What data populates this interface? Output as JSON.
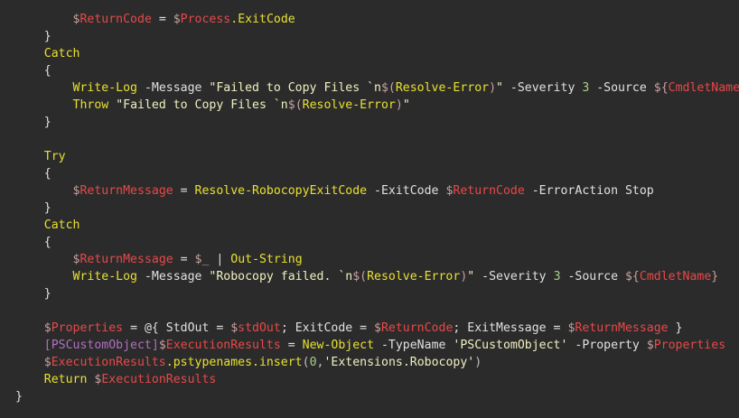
{
  "editor": {
    "lines": [
      [
        {
          "t": "        ",
          "k": "plain"
        },
        {
          "t": "$",
          "k": "dollar"
        },
        {
          "t": "ReturnCode",
          "k": "var"
        },
        {
          "t": " = ",
          "k": "operator"
        },
        {
          "t": "$",
          "k": "dollar"
        },
        {
          "t": "Process",
          "k": "var"
        },
        {
          "t": ".ExitCode",
          "k": "cmdlet"
        }
      ],
      [
        {
          "t": "    }",
          "k": "plain"
        }
      ],
      [
        {
          "t": "    ",
          "k": "plain"
        },
        {
          "t": "Catch",
          "k": "keyword"
        }
      ],
      [
        {
          "t": "    {",
          "k": "plain"
        }
      ],
      [
        {
          "t": "        ",
          "k": "plain"
        },
        {
          "t": "Write-Log",
          "k": "cmdlet"
        },
        {
          "t": " -Message ",
          "k": "param"
        },
        {
          "t": "\"Failed to Copy Files `n",
          "k": "string"
        },
        {
          "t": "$(",
          "k": "dollar"
        },
        {
          "t": "Resolve-Error",
          "k": "cmdlet"
        },
        {
          "t": ")",
          "k": "dollar"
        },
        {
          "t": "\"",
          "k": "string"
        },
        {
          "t": " -Severity ",
          "k": "param"
        },
        {
          "t": "3",
          "k": "number"
        },
        {
          "t": " -Source ",
          "k": "param"
        },
        {
          "t": "${",
          "k": "dollar"
        },
        {
          "t": "CmdletName",
          "k": "var"
        },
        {
          "t": "}",
          "k": "dollar"
        }
      ],
      [
        {
          "t": "        ",
          "k": "plain"
        },
        {
          "t": "Throw",
          "k": "keyword"
        },
        {
          "t": " ",
          "k": "plain"
        },
        {
          "t": "\"Failed to Copy Files `n",
          "k": "string"
        },
        {
          "t": "$(",
          "k": "dollar"
        },
        {
          "t": "Resolve-Error",
          "k": "cmdlet"
        },
        {
          "t": ")",
          "k": "dollar"
        },
        {
          "t": "\"",
          "k": "string"
        }
      ],
      [
        {
          "t": "    }",
          "k": "plain"
        }
      ],
      [],
      [
        {
          "t": "    ",
          "k": "plain"
        },
        {
          "t": "Try",
          "k": "keyword"
        }
      ],
      [
        {
          "t": "    {",
          "k": "plain"
        }
      ],
      [
        {
          "t": "        ",
          "k": "plain"
        },
        {
          "t": "$",
          "k": "dollar"
        },
        {
          "t": "ReturnMessage",
          "k": "var"
        },
        {
          "t": " = ",
          "k": "operator"
        },
        {
          "t": "Resolve-RobocopyExitCode",
          "k": "cmdlet"
        },
        {
          "t": " -ExitCode ",
          "k": "param"
        },
        {
          "t": "$",
          "k": "dollar"
        },
        {
          "t": "ReturnCode",
          "k": "var"
        },
        {
          "t": " -ErrorAction Stop",
          "k": "param"
        }
      ],
      [
        {
          "t": "    }",
          "k": "plain"
        }
      ],
      [
        {
          "t": "    ",
          "k": "plain"
        },
        {
          "t": "Catch",
          "k": "keyword"
        }
      ],
      [
        {
          "t": "    {",
          "k": "plain"
        }
      ],
      [
        {
          "t": "        ",
          "k": "plain"
        },
        {
          "t": "$",
          "k": "dollar"
        },
        {
          "t": "ReturnMessage",
          "k": "var"
        },
        {
          "t": " = ",
          "k": "operator"
        },
        {
          "t": "$_",
          "k": "dollar"
        },
        {
          "t": " | ",
          "k": "operator"
        },
        {
          "t": "Out-String",
          "k": "cmdlet"
        }
      ],
      [
        {
          "t": "        ",
          "k": "plain"
        },
        {
          "t": "Write-Log",
          "k": "cmdlet"
        },
        {
          "t": " -Message ",
          "k": "param"
        },
        {
          "t": "\"Robocopy failed. `n",
          "k": "string"
        },
        {
          "t": "$(",
          "k": "dollar"
        },
        {
          "t": "Resolve-Error",
          "k": "cmdlet"
        },
        {
          "t": ")",
          "k": "dollar"
        },
        {
          "t": "\"",
          "k": "string"
        },
        {
          "t": " -Severity ",
          "k": "param"
        },
        {
          "t": "3",
          "k": "number"
        },
        {
          "t": " -Source ",
          "k": "param"
        },
        {
          "t": "${",
          "k": "dollar"
        },
        {
          "t": "CmdletName",
          "k": "var"
        },
        {
          "t": "}",
          "k": "dollar"
        }
      ],
      [
        {
          "t": "    }",
          "k": "plain"
        }
      ],
      [],
      [
        {
          "t": "    ",
          "k": "plain"
        },
        {
          "t": "$",
          "k": "dollar"
        },
        {
          "t": "Properties",
          "k": "var"
        },
        {
          "t": " = @{ StdOut = ",
          "k": "operator"
        },
        {
          "t": "$",
          "k": "dollar"
        },
        {
          "t": "stdOut",
          "k": "var"
        },
        {
          "t": "; ExitCode = ",
          "k": "operator"
        },
        {
          "t": "$",
          "k": "dollar"
        },
        {
          "t": "ReturnCode",
          "k": "var"
        },
        {
          "t": "; ExitMessage = ",
          "k": "operator"
        },
        {
          "t": "$",
          "k": "dollar"
        },
        {
          "t": "ReturnMessage",
          "k": "var"
        },
        {
          "t": " }",
          "k": "operator"
        }
      ],
      [
        {
          "t": "    ",
          "k": "plain"
        },
        {
          "t": "[PSCustomObject]",
          "k": "type"
        },
        {
          "t": "$",
          "k": "dollar"
        },
        {
          "t": "ExecutionResults",
          "k": "var"
        },
        {
          "t": " = ",
          "k": "operator"
        },
        {
          "t": "New-Object",
          "k": "cmdlet"
        },
        {
          "t": " -TypeName ",
          "k": "param"
        },
        {
          "t": "'PSCustomObject'",
          "k": "string"
        },
        {
          "t": " -Property ",
          "k": "param"
        },
        {
          "t": "$",
          "k": "dollar"
        },
        {
          "t": "Properties",
          "k": "var"
        }
      ],
      [
        {
          "t": "    ",
          "k": "plain"
        },
        {
          "t": "$",
          "k": "dollar"
        },
        {
          "t": "ExecutionResults",
          "k": "var"
        },
        {
          "t": ".pstypenames.insert",
          "k": "cmdlet"
        },
        {
          "t": "(",
          "k": "punct"
        },
        {
          "t": "0",
          "k": "number"
        },
        {
          "t": ",",
          "k": "punct"
        },
        {
          "t": "'Extensions.Robocopy'",
          "k": "string"
        },
        {
          "t": ")",
          "k": "punct"
        }
      ],
      [
        {
          "t": "    ",
          "k": "plain"
        },
        {
          "t": "Return",
          "k": "keyword"
        },
        {
          "t": " ",
          "k": "plain"
        },
        {
          "t": "$",
          "k": "dollar"
        },
        {
          "t": "ExecutionResults",
          "k": "var"
        }
      ],
      [
        {
          "t": "}",
          "k": "plain"
        }
      ]
    ]
  },
  "colors": {
    "background": "#2b2b2b",
    "keyword": "#e8e030",
    "variable": "#e84848",
    "string": "#f0f0c0"
  }
}
